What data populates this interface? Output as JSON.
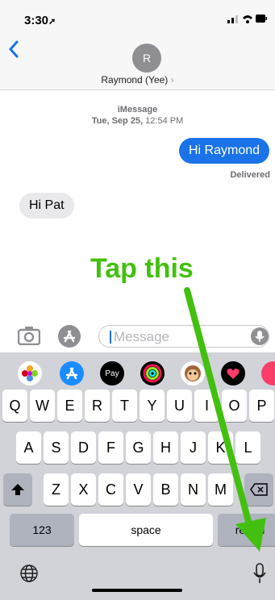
{
  "status_bar": {
    "time": "3:30",
    "location_glyph": "➚"
  },
  "header": {
    "back_icon": "chevron-left-icon",
    "avatar_initial": "R",
    "contact_name": "Raymond (Yee)",
    "contact_chevron": "›"
  },
  "conversation": {
    "service": "iMessage",
    "date_bold": "Tue, Sep 25,",
    "date_time": " 12:54 PM",
    "outgoing": "Hi Raymond",
    "delivered": "Delivered",
    "incoming": "Hi Pat"
  },
  "annotation": {
    "text": "Tap this",
    "color": "#43c00f"
  },
  "input": {
    "placeholder": "Message"
  },
  "keyboard": {
    "row1": [
      "Q",
      "W",
      "E",
      "R",
      "T",
      "Y",
      "U",
      "I",
      "O",
      "P"
    ],
    "row2": [
      "A",
      "S",
      "D",
      "F",
      "G",
      "H",
      "J",
      "K",
      "L"
    ],
    "row3": [
      "Z",
      "X",
      "C",
      "V",
      "B",
      "N",
      "M"
    ],
    "numbers_label": "123",
    "space_label": "space",
    "return_label": "return",
    "apple_pay_label": "Pay"
  },
  "colors": {
    "accent": "#1a73e8",
    "keyboard_bg": "#d1d3d9",
    "arrow": "#43c00f"
  }
}
